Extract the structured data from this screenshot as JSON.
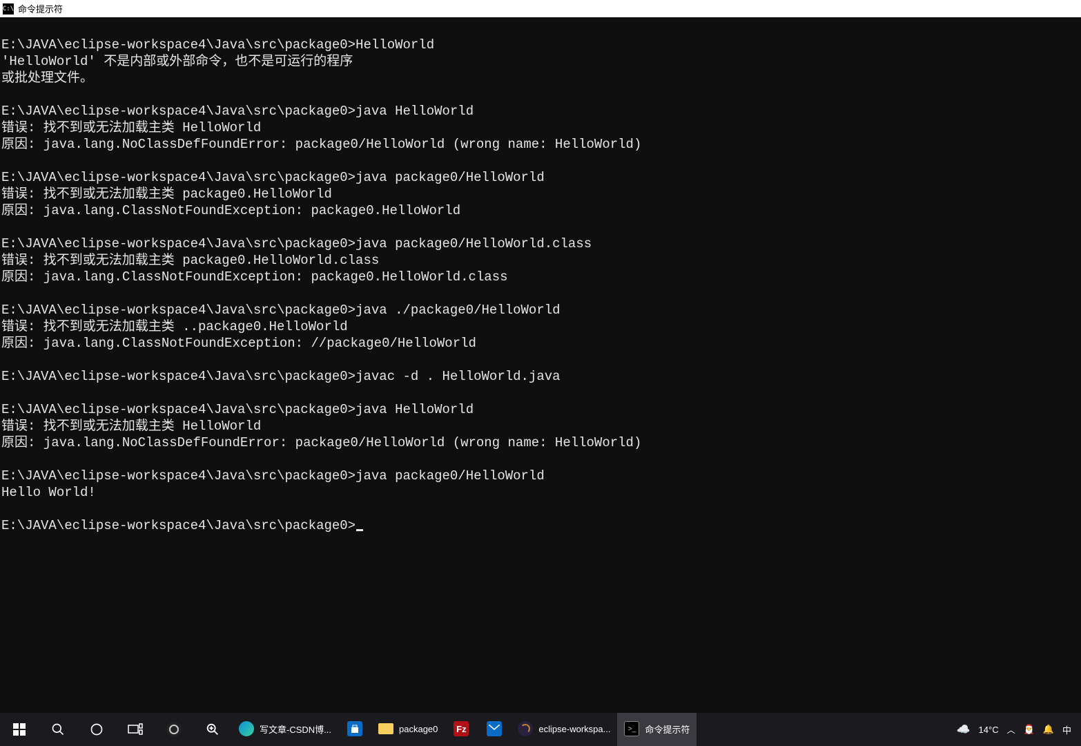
{
  "window": {
    "title": "命令提示符",
    "icon_label": "C:\\"
  },
  "terminal": {
    "lines": [
      "",
      "E:\\JAVA\\eclipse-workspace4\\Java\\src\\package0>HelloWorld",
      "'HelloWorld' 不是内部或外部命令，也不是可运行的程序",
      "或批处理文件。",
      "",
      "E:\\JAVA\\eclipse-workspace4\\Java\\src\\package0>java HelloWorld",
      "错误: 找不到或无法加载主类 HelloWorld",
      "原因: java.lang.NoClassDefFoundError: package0/HelloWorld (wrong name: HelloWorld)",
      "",
      "E:\\JAVA\\eclipse-workspace4\\Java\\src\\package0>java package0/HelloWorld",
      "错误: 找不到或无法加载主类 package0.HelloWorld",
      "原因: java.lang.ClassNotFoundException: package0.HelloWorld",
      "",
      "E:\\JAVA\\eclipse-workspace4\\Java\\src\\package0>java package0/HelloWorld.class",
      "错误: 找不到或无法加载主类 package0.HelloWorld.class",
      "原因: java.lang.ClassNotFoundException: package0.HelloWorld.class",
      "",
      "E:\\JAVA\\eclipse-workspace4\\Java\\src\\package0>java ./package0/HelloWorld",
      "错误: 找不到或无法加载主类 ..package0.HelloWorld",
      "原因: java.lang.ClassNotFoundException: //package0/HelloWorld",
      "",
      "E:\\JAVA\\eclipse-workspace4\\Java\\src\\package0>javac -d . HelloWorld.java",
      "",
      "E:\\JAVA\\eclipse-workspace4\\Java\\src\\package0>java HelloWorld",
      "错误: 找不到或无法加载主类 HelloWorld",
      "原因: java.lang.NoClassDefFoundError: package0/HelloWorld (wrong name: HelloWorld)",
      "",
      "E:\\JAVA\\eclipse-workspace4\\Java\\src\\package0>java package0/HelloWorld",
      "Hello World!",
      "",
      "E:\\JAVA\\eclipse-workspace4\\Java\\src\\package0>"
    ]
  },
  "taskbar": {
    "apps": [
      {
        "id": "edge",
        "label": "写文章-CSDN博..."
      },
      {
        "id": "store",
        "label": ""
      },
      {
        "id": "explorer",
        "label": "package0"
      },
      {
        "id": "filezilla",
        "label": ""
      },
      {
        "id": "mail",
        "label": ""
      },
      {
        "id": "eclipse",
        "label": "eclipse-workspa..."
      },
      {
        "id": "cmd",
        "label": "命令提示符",
        "active": true
      }
    ],
    "weather": {
      "temp": "14°C"
    }
  }
}
